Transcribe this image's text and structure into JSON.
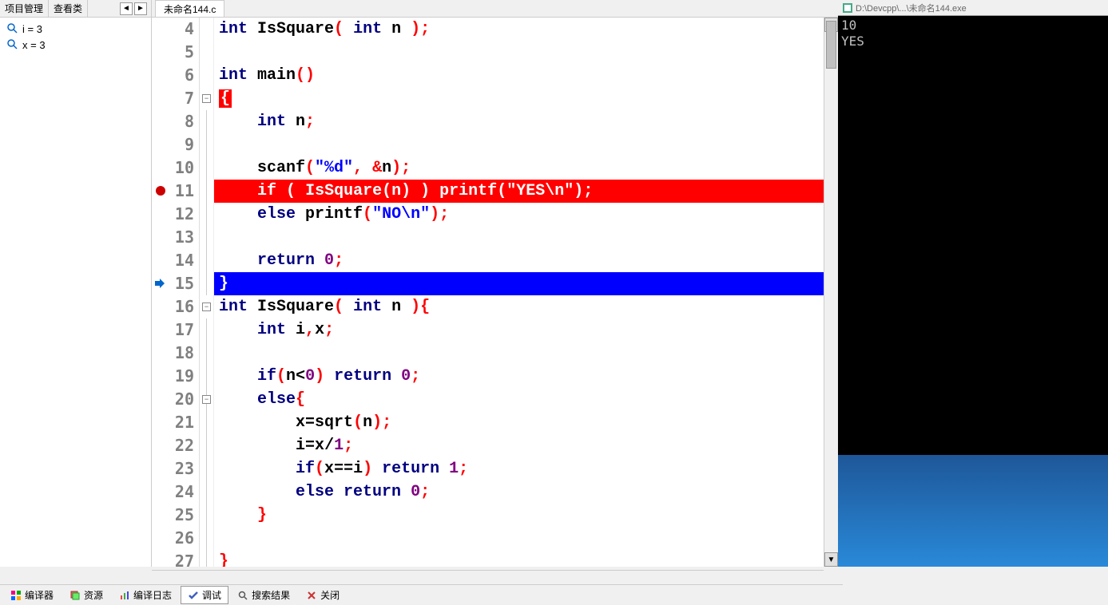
{
  "leftPanel": {
    "tabs": [
      "项目管理",
      "查看类"
    ],
    "watch": [
      {
        "name": "i",
        "value": "3"
      },
      {
        "name": "x",
        "value": "3"
      }
    ]
  },
  "fileTab": "未命名144.c",
  "consoleTitle": "D:\\Devcpp\\...\\未命名144.exe",
  "console": [
    "10",
    "YES"
  ],
  "bottomTabs": [
    {
      "label": "编译器",
      "icon": "grid"
    },
    {
      "label": "资源",
      "icon": "stack"
    },
    {
      "label": "编译日志",
      "icon": "bars"
    },
    {
      "label": "调试",
      "icon": "check",
      "active": true
    },
    {
      "label": "搜索结果",
      "icon": "search"
    },
    {
      "label": "关闭",
      "icon": "close"
    }
  ],
  "code": {
    "firstLine": 4,
    "highlightRed": 11,
    "highlightBlue": 15,
    "foldOpen": [
      7,
      16,
      20
    ],
    "foldLineRanges": [
      [
        8,
        15
      ],
      [
        17,
        27
      ],
      [
        21,
        25
      ]
    ],
    "breakpointIcon": 11,
    "stepIcon": 15,
    "lines": [
      {
        "n": 4,
        "tokens": [
          [
            "kw",
            "int"
          ],
          [
            "id",
            " IsSquare"
          ],
          [
            "punc",
            "("
          ],
          [
            "id",
            " "
          ],
          [
            "kw",
            "int"
          ],
          [
            "id",
            " n "
          ],
          [
            "punc",
            ");"
          ]
        ]
      },
      {
        "n": 5,
        "tokens": []
      },
      {
        "n": 6,
        "tokens": [
          [
            "kw",
            "int"
          ],
          [
            "id",
            " main"
          ],
          [
            "punc",
            "()"
          ]
        ]
      },
      {
        "n": 7,
        "tokens": [
          [
            "brace",
            "{"
          ]
        ]
      },
      {
        "n": 8,
        "tokens": [
          [
            "id",
            "    "
          ],
          [
            "kw",
            "int"
          ],
          [
            "id",
            " n"
          ],
          [
            "punc",
            ";"
          ]
        ]
      },
      {
        "n": 9,
        "tokens": []
      },
      {
        "n": 10,
        "tokens": [
          [
            "id",
            "    scanf"
          ],
          [
            "punc",
            "("
          ],
          [
            "str",
            "\"%d\""
          ],
          [
            "punc",
            ","
          ],
          [
            "id",
            " "
          ],
          [
            "punc",
            "&"
          ],
          [
            "id",
            "n"
          ],
          [
            "punc",
            ");"
          ]
        ]
      },
      {
        "n": 11,
        "tokens": [
          [
            "id",
            "    "
          ],
          [
            "kw",
            "if"
          ],
          [
            "id",
            " "
          ],
          [
            "punc",
            "("
          ],
          [
            "id",
            " IsSquare"
          ],
          [
            "punc",
            "("
          ],
          [
            "id",
            "n"
          ],
          [
            "punc",
            ")"
          ],
          [
            "id",
            " "
          ],
          [
            "punc",
            ")"
          ],
          [
            "id",
            " printf"
          ],
          [
            "punc",
            "("
          ],
          [
            "str",
            "\"YES\\n\""
          ],
          [
            "punc",
            ");"
          ]
        ]
      },
      {
        "n": 12,
        "tokens": [
          [
            "id",
            "    "
          ],
          [
            "kw",
            "else"
          ],
          [
            "id",
            " printf"
          ],
          [
            "punc",
            "("
          ],
          [
            "str",
            "\"NO\\n\""
          ],
          [
            "punc",
            ");"
          ]
        ]
      },
      {
        "n": 13,
        "tokens": []
      },
      {
        "n": 14,
        "tokens": [
          [
            "id",
            "    "
          ],
          [
            "kw",
            "return"
          ],
          [
            "id",
            " "
          ],
          [
            "num",
            "0"
          ],
          [
            "punc",
            ";"
          ]
        ]
      },
      {
        "n": 15,
        "tokens": [
          [
            "punc",
            "}"
          ]
        ]
      },
      {
        "n": 16,
        "tokens": [
          [
            "kw",
            "int"
          ],
          [
            "id",
            " IsSquare"
          ],
          [
            "punc",
            "("
          ],
          [
            "id",
            " "
          ],
          [
            "kw",
            "int"
          ],
          [
            "id",
            " n "
          ],
          [
            "punc",
            "){"
          ]
        ]
      },
      {
        "n": 17,
        "tokens": [
          [
            "id",
            "    "
          ],
          [
            "kw",
            "int"
          ],
          [
            "id",
            " i"
          ],
          [
            "punc",
            ","
          ],
          [
            "id",
            "x"
          ],
          [
            "punc",
            ";"
          ]
        ]
      },
      {
        "n": 18,
        "tokens": []
      },
      {
        "n": 19,
        "tokens": [
          [
            "id",
            "    "
          ],
          [
            "kw",
            "if"
          ],
          [
            "punc",
            "("
          ],
          [
            "id",
            "n"
          ],
          [
            "op",
            "<"
          ],
          [
            "num",
            "0"
          ],
          [
            "punc",
            ")"
          ],
          [
            "id",
            " "
          ],
          [
            "kw",
            "return"
          ],
          [
            "id",
            " "
          ],
          [
            "num",
            "0"
          ],
          [
            "punc",
            ";"
          ]
        ]
      },
      {
        "n": 20,
        "tokens": [
          [
            "id",
            "    "
          ],
          [
            "kw",
            "else"
          ],
          [
            "punc",
            "{"
          ]
        ]
      },
      {
        "n": 21,
        "tokens": [
          [
            "id",
            "        x"
          ],
          [
            "op",
            "="
          ],
          [
            "id",
            "sqrt"
          ],
          [
            "punc",
            "("
          ],
          [
            "id",
            "n"
          ],
          [
            "punc",
            ");"
          ]
        ]
      },
      {
        "n": 22,
        "tokens": [
          [
            "id",
            "        i"
          ],
          [
            "op",
            "="
          ],
          [
            "id",
            "x"
          ],
          [
            "op",
            "/"
          ],
          [
            "num",
            "1"
          ],
          [
            "punc",
            ";"
          ]
        ]
      },
      {
        "n": 23,
        "tokens": [
          [
            "id",
            "        "
          ],
          [
            "kw",
            "if"
          ],
          [
            "punc",
            "("
          ],
          [
            "id",
            "x"
          ],
          [
            "op",
            "=="
          ],
          [
            "id",
            "i"
          ],
          [
            "punc",
            ")"
          ],
          [
            "id",
            " "
          ],
          [
            "kw",
            "return"
          ],
          [
            "id",
            " "
          ],
          [
            "num",
            "1"
          ],
          [
            "punc",
            ";"
          ]
        ]
      },
      {
        "n": 24,
        "tokens": [
          [
            "id",
            "        "
          ],
          [
            "kw",
            "else"
          ],
          [
            "id",
            " "
          ],
          [
            "kw",
            "return"
          ],
          [
            "id",
            " "
          ],
          [
            "num",
            "0"
          ],
          [
            "punc",
            ";"
          ]
        ]
      },
      {
        "n": 25,
        "tokens": [
          [
            "id",
            "    "
          ],
          [
            "punc",
            "}"
          ]
        ]
      },
      {
        "n": 26,
        "tokens": []
      },
      {
        "n": 27,
        "tokens": [
          [
            "punc",
            "}"
          ]
        ]
      }
    ]
  }
}
